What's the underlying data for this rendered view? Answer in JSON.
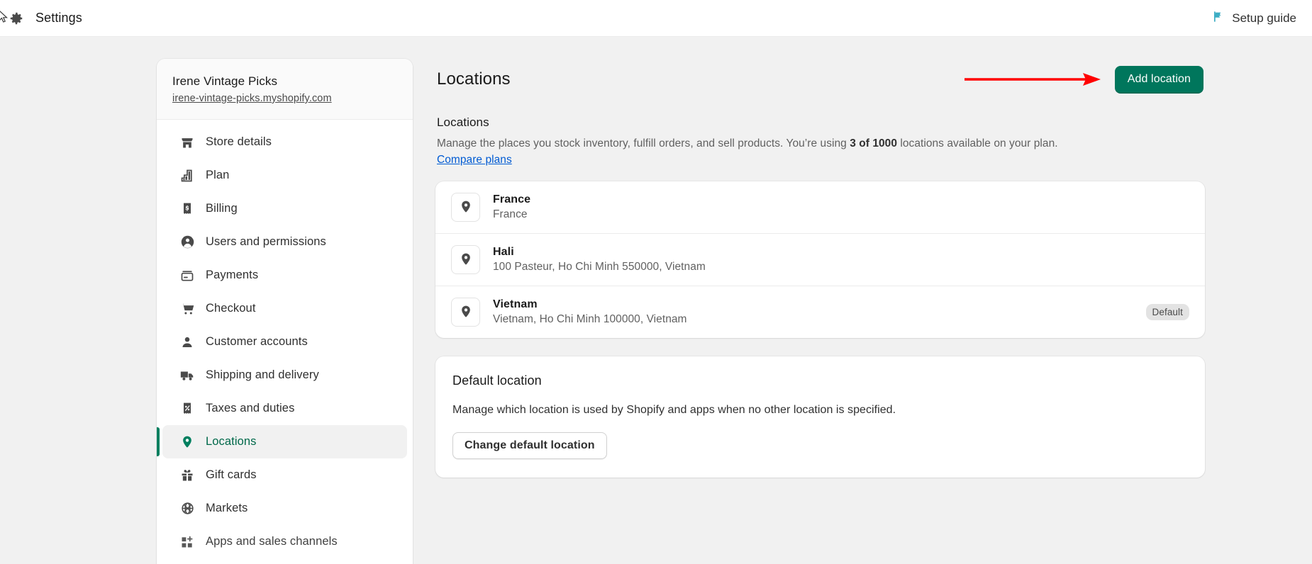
{
  "topbar": {
    "title": "Settings",
    "gear_icon": "gear-icon",
    "cursor_icon": "cursor-arrow-icon",
    "setup_guide_label": "Setup guide",
    "setup_guide_icon": "flag-icon",
    "flag_color": "#3dadc4"
  },
  "sidebar": {
    "store_name": "Irene Vintage Picks",
    "store_url": "irene-vintage-picks.myshopify.com",
    "items": [
      {
        "label": "Store details",
        "icon": "store-icon",
        "active": false
      },
      {
        "label": "Plan",
        "icon": "plan-icon",
        "active": false
      },
      {
        "label": "Billing",
        "icon": "billing-icon",
        "active": false
      },
      {
        "label": "Users and permissions",
        "icon": "user-circle-icon",
        "active": false
      },
      {
        "label": "Payments",
        "icon": "credit-card-icon",
        "active": false
      },
      {
        "label": "Checkout",
        "icon": "cart-icon",
        "active": false
      },
      {
        "label": "Customer accounts",
        "icon": "person-icon",
        "active": false
      },
      {
        "label": "Shipping and delivery",
        "icon": "truck-icon",
        "active": false
      },
      {
        "label": "Taxes and duties",
        "icon": "percent-receipt-icon",
        "active": false
      },
      {
        "label": "Locations",
        "icon": "location-pin-icon",
        "active": true
      },
      {
        "label": "Gift cards",
        "icon": "gift-icon",
        "active": false
      },
      {
        "label": "Markets",
        "icon": "globe-icon",
        "active": false
      },
      {
        "label": "Apps and sales channels",
        "icon": "apps-plus-icon",
        "active": false
      }
    ]
  },
  "main": {
    "page_title": "Locations",
    "add_location_label": "Add location",
    "annotation": {
      "type": "arrow",
      "color": "#ff0000",
      "points_to": "add-location-button"
    },
    "locations_section": {
      "title": "Locations",
      "description_before": "Manage the places you stock inventory, fulfill orders, and sell products. You’re using ",
      "description_bold": "3 of 1000",
      "description_after": " locations available on your plan. ",
      "link_label": "Compare plans",
      "locations": [
        {
          "name": "France",
          "address": "France",
          "badge": ""
        },
        {
          "name": "Hali",
          "address": "100 Pasteur, Ho Chi Minh 550000, Vietnam",
          "badge": ""
        },
        {
          "name": "Vietnam",
          "address": "Vietnam, Ho Chi Minh 100000, Vietnam",
          "badge": "Default"
        }
      ]
    },
    "default_section": {
      "title": "Default location",
      "description": "Manage which location is used by Shopify and apps when no other location is specified.",
      "button_label": "Change default location"
    }
  },
  "colors": {
    "brand_green": "#00765c",
    "active_green": "#00694a",
    "link_blue": "#005bd3",
    "annotation_red": "#ff0000",
    "page_bg": "#f1f1f1"
  }
}
